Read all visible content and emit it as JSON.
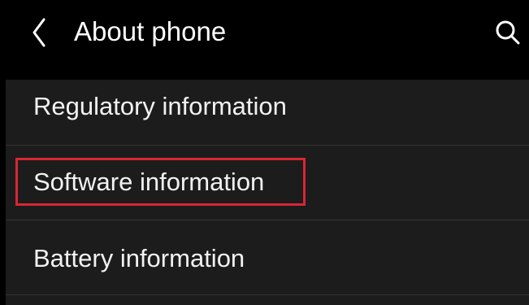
{
  "header": {
    "title": "About phone",
    "back_icon": "chevron-left-icon",
    "search_icon": "search-icon"
  },
  "menu": {
    "items": [
      {
        "label": "Regulatory information"
      },
      {
        "label": "Software information",
        "highlighted": true
      },
      {
        "label": "Battery information"
      }
    ]
  },
  "colors": {
    "background": "#000000",
    "panel": "#1c1c1c",
    "divider": "#333333",
    "text": "#f2f2f2",
    "highlight": "#d92633"
  }
}
